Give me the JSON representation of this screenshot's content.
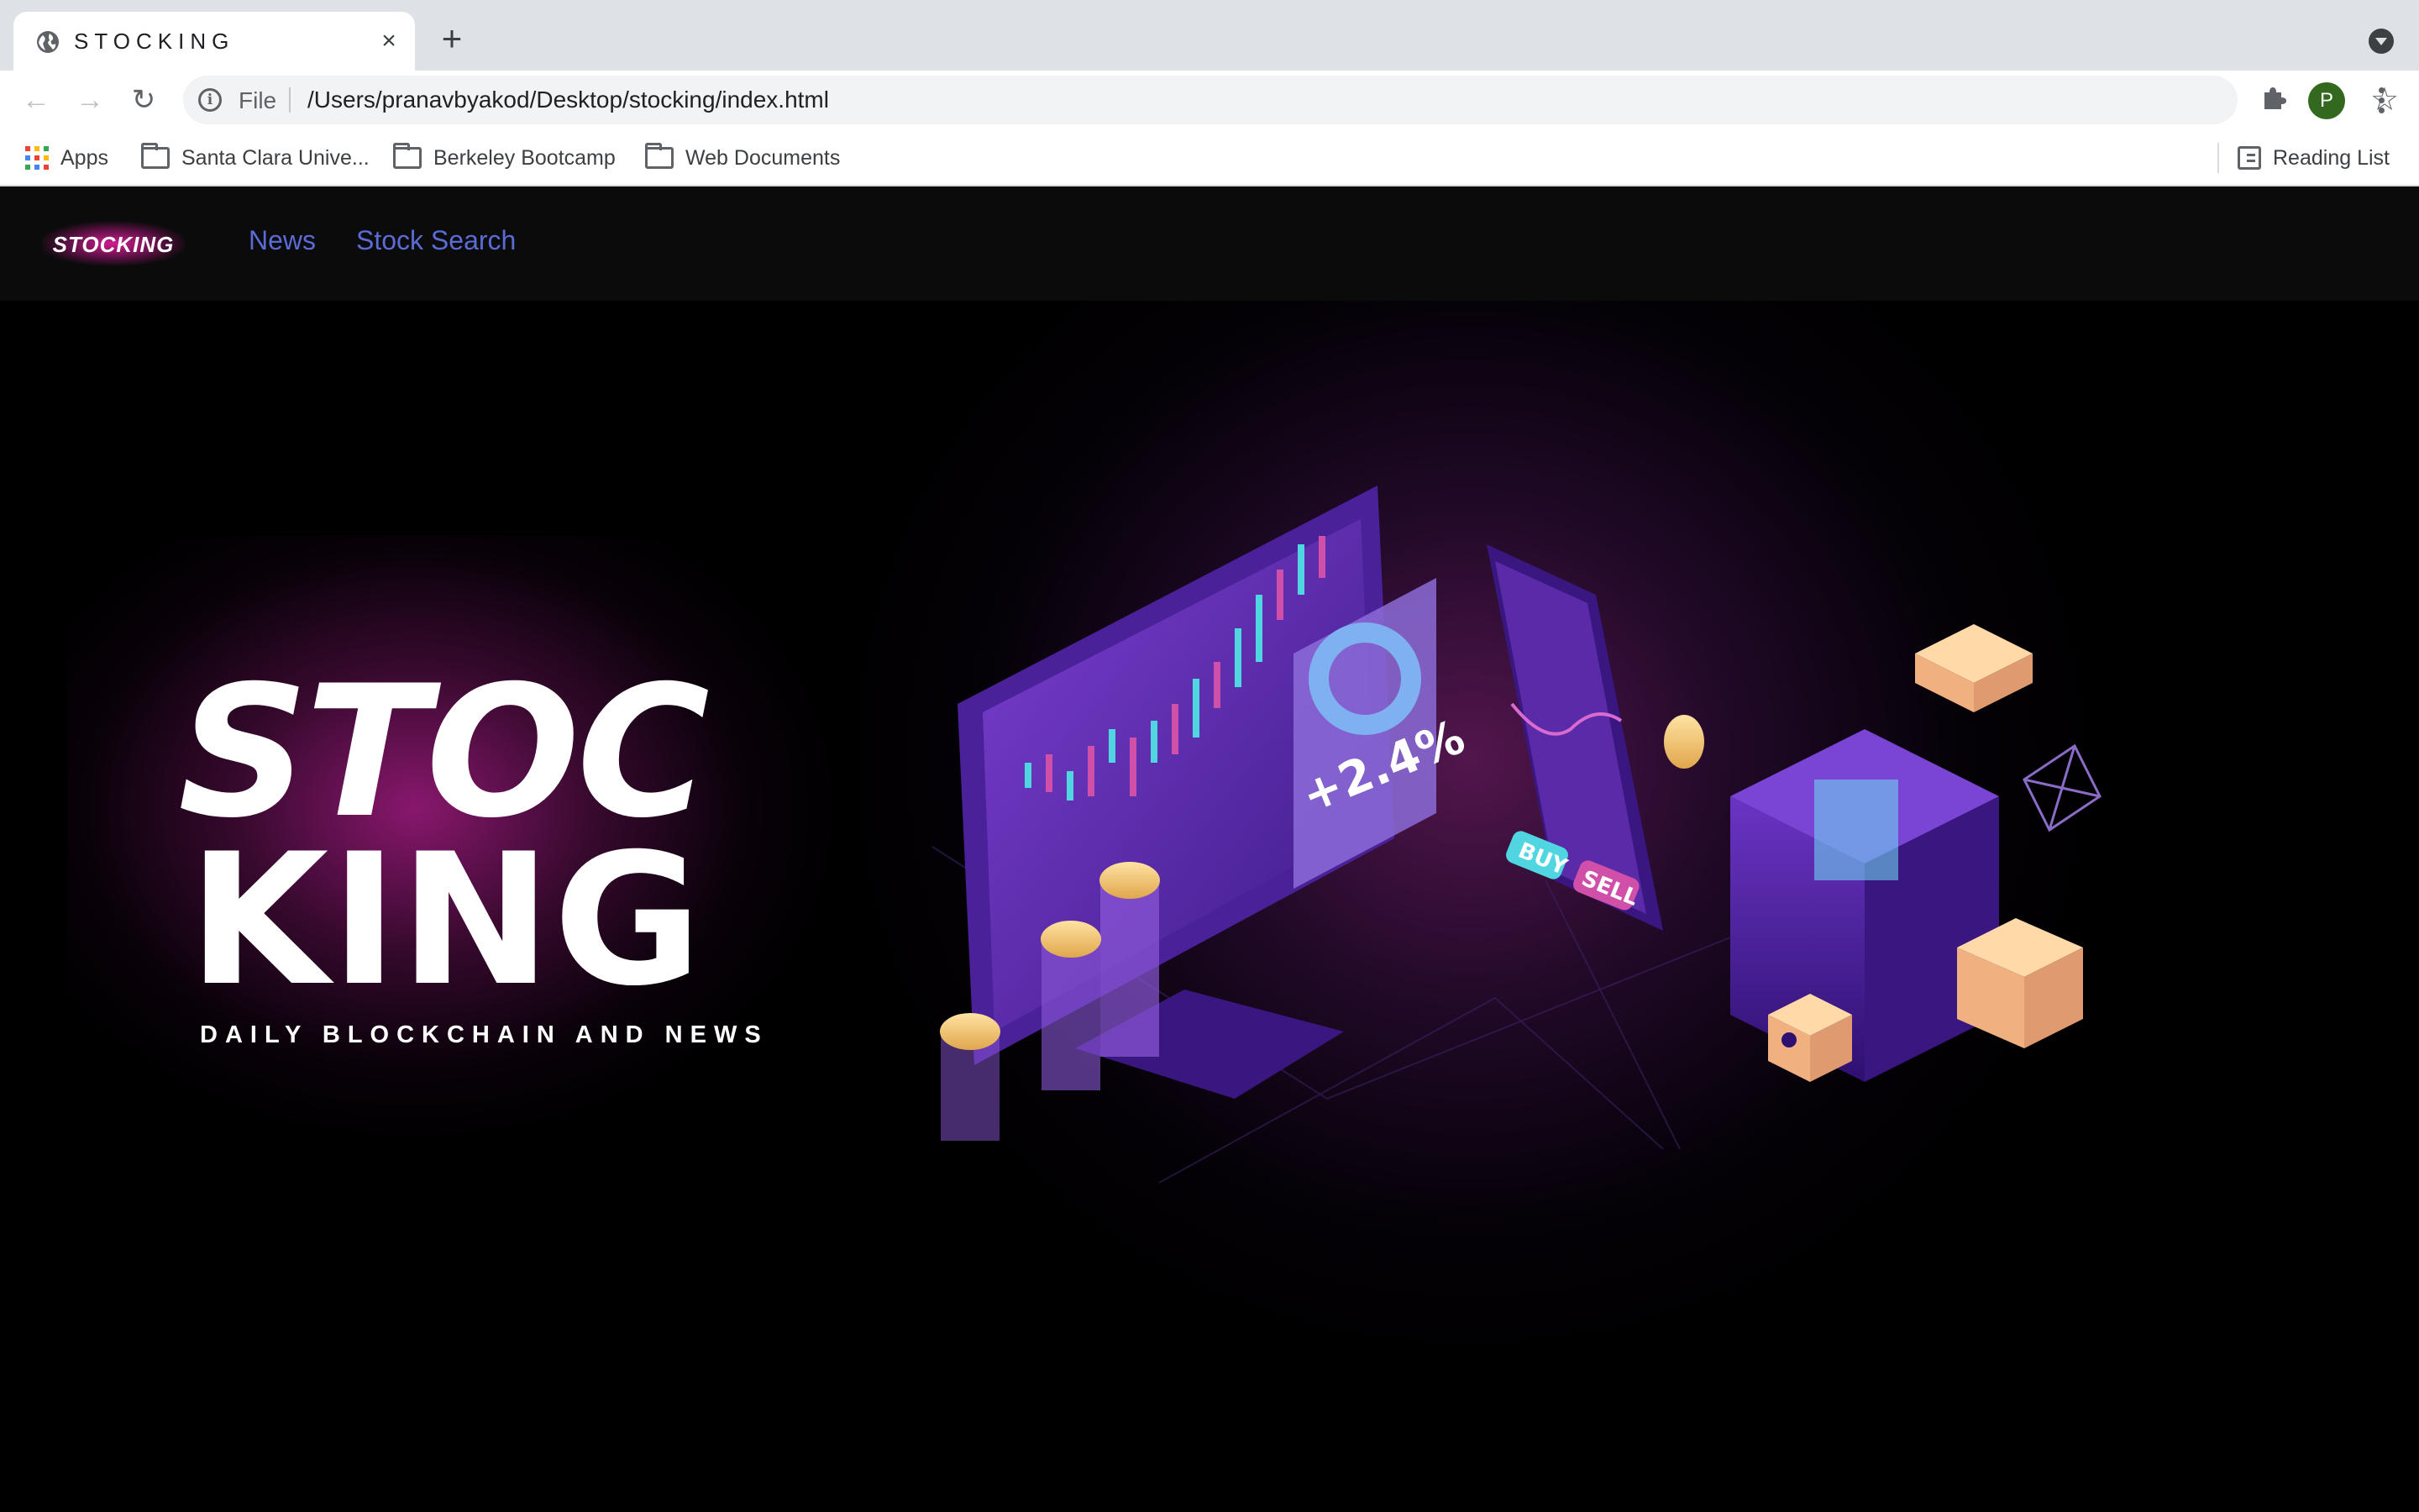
{
  "browser": {
    "tab_title": "STOCKING",
    "omnibox_scheme": "File",
    "url": "/Users/pranavbyakod/Desktop/stocking/index.html",
    "profile_initial": "P",
    "bookmarks": [
      {
        "label": "Apps",
        "icon": "apps-grid-icon"
      },
      {
        "label": "Santa Clara Unive...",
        "icon": "folder-icon"
      },
      {
        "label": "Berkeley Bootcamp",
        "icon": "folder-icon"
      },
      {
        "label": "Web Documents",
        "icon": "folder-icon"
      }
    ],
    "reading_list": "Reading List"
  },
  "site": {
    "brand": "STOCKING",
    "nav": [
      "News",
      "Stock Search"
    ],
    "hero": {
      "line1": "STOC",
      "line2": "KING",
      "subtitle": "DAILY BLOCKCHAIN AND NEWS",
      "illustration": {
        "percent_label": "+2.4%",
        "buy_label": "BUY",
        "sell_label": "SELL"
      }
    }
  },
  "colors": {
    "nav_link": "#5b6bd6",
    "hero_glow": "#b01e8c",
    "illustration_purple": "#5a2aa8"
  }
}
